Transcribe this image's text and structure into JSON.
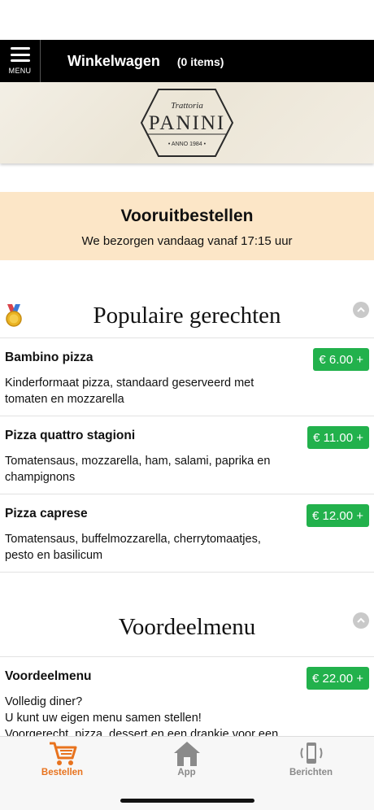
{
  "header": {
    "menu_label": "MENU",
    "cart_title": "Winkelwagen",
    "cart_count": "(0 items)"
  },
  "banner": {
    "logo_top": "Trattoria",
    "logo_main": "PANINI",
    "logo_bottom": "• ANNO 1984 •"
  },
  "order": {
    "title": "Vooruitbestellen",
    "subtitle": "We bezorgen vandaag vanaf 17:15 uur"
  },
  "sections": [
    {
      "title": "Populaire gerechten",
      "icon": "medal-icon",
      "items": [
        {
          "name": "Bambino pizza",
          "desc": "Kinderformaat pizza, standaard geserveerd met tomaten en mozzarella",
          "price": "€ 6.00 +"
        },
        {
          "name": "Pizza quattro stagioni",
          "desc": "Tomatensaus, mozzarella, ham, salami, paprika en champignons",
          "price": "€ 11.00 +"
        },
        {
          "name": "Pizza caprese",
          "desc": "Tomatensaus, buffelmozzarella, cherrytomaatjes, pesto en basilicum",
          "price": "€ 12.00 +"
        }
      ]
    },
    {
      "title": "Voordeelmenu",
      "items": [
        {
          "name": "Voordeelmenu",
          "desc_lines": [
            "Volledig diner?",
            "U kunt uw eigen menu samen stellen!",
            "Voorgerecht, pizza, dessert en een drankje voor een"
          ],
          "price": "€ 22.00 +"
        }
      ]
    }
  ],
  "tabbar": {
    "tabs": [
      {
        "label": "Bestellen",
        "icon": "cart-icon",
        "active": true
      },
      {
        "label": "App",
        "icon": "home-icon",
        "active": false
      },
      {
        "label": "Berichten",
        "icon": "phone-icon",
        "active": false
      }
    ]
  },
  "colors": {
    "accent": "#e8731e",
    "price_button": "#22b14c",
    "order_box": "#fce6c7",
    "topbar": "#000000",
    "inactive_tab": "#8a8a8a"
  }
}
